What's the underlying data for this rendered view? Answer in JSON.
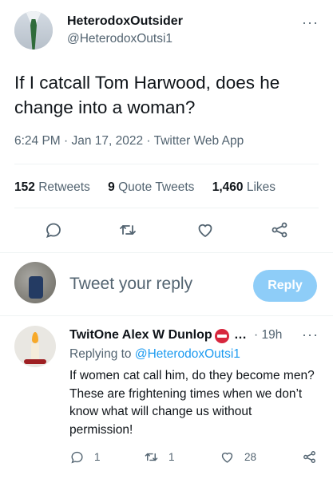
{
  "tweet": {
    "author": {
      "display_name": "HeterodoxOutsider",
      "handle": "@HeterodoxOutsi1"
    },
    "text": "If I catcall Tom Harwood, does he change into a woman?",
    "meta": "6:24 PM · Jan 17, 2022 · Twitter Web App",
    "stats": {
      "retweets_count": "152",
      "retweets_label": "Retweets",
      "quotes_count": "9",
      "quotes_label": "Quote Tweets",
      "likes_count": "1,460",
      "likes_label": "Likes"
    },
    "more_glyph": "···"
  },
  "compose": {
    "placeholder": "Tweet your reply",
    "button_label": "Reply"
  },
  "reply": {
    "display_name": "TwitOne Alex W Dunlop",
    "ellipsis": "…",
    "time": "· 19h",
    "more_glyph": "···",
    "replying_prefix": "Replying to",
    "replying_handle": "@HeterodoxOutsi1",
    "text": "If women cat call him, do they become men? These are frightening times when we don’t know what will change us without permission!",
    "reply_count": "1",
    "retweet_count": "1",
    "like_count": "28"
  },
  "icons": [
    "reply-icon",
    "retweet-icon",
    "like-icon",
    "share-icon",
    "no-entry-icon"
  ],
  "colors": {
    "accent": "#1d9bf0",
    "reply_button": "#8ecdf8",
    "muted": "#536471"
  }
}
